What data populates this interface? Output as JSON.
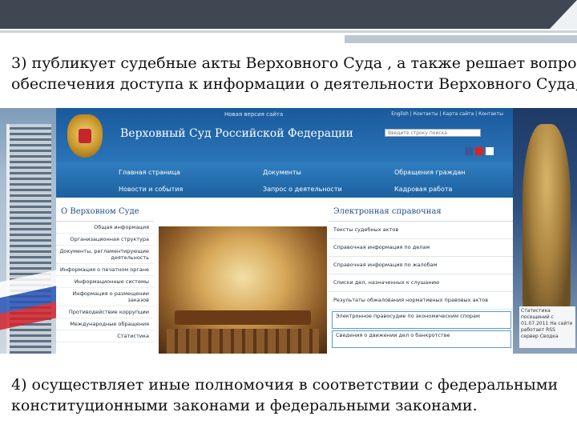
{
  "slide": {
    "item3_line1": "3) публикует судебные акты Верховного Суда , а также решает вопросы",
    "item3_line2": "обеспечения доступа к информации о деятельности Верховного Суда;",
    "item4_line1": "4) осуществляет иные полномочия в соответствии с федеральными",
    "item4_line2": "конституционными законами и федеральными законами."
  },
  "site": {
    "new_version": "Новая версия сайта",
    "top_links": "English | Контакты | Карта сайта | Контакты",
    "name": "Верховный Суд Российской Федерации",
    "search_placeholder": "Введите строку поиска",
    "nav": [
      "Главная страница",
      "Документы",
      "Обращения граждан",
      "Новости и события",
      "Запрос о деятельности",
      "Кадровая работа"
    ],
    "left_heading": "О Верховном Суде",
    "left_menu": [
      "Общая информация",
      "Организационная структура",
      "Документы, регламентирующие деятельность",
      "Информация о печатном органе",
      "Информационные системы",
      "Информация о размещении заказов",
      "Противодействие коррупции",
      "Международные обращения",
      "Статистика"
    ],
    "right_heading": "Электронная справочная",
    "right_menu": [
      "Тексты судебных актов",
      "Справочная информация по делам",
      "Справочная информация по жалобам",
      "Списки дел, назначенных к слушанию",
      "Результаты обжалования нормативных правовых актов",
      "Электронное правосудие по экономическим спорам",
      "Сведения о движении дел о банкротстве"
    ],
    "stats_box": "Статистика посещений с 01.07.2011 На сайте работает RSS сервер Сводка"
  },
  "colors": {
    "site_header": "#1a5a9c",
    "nav_bar": "#2f7dbf",
    "heading_text": "#1f4f8a",
    "slide_topbar": "#3e4752"
  }
}
